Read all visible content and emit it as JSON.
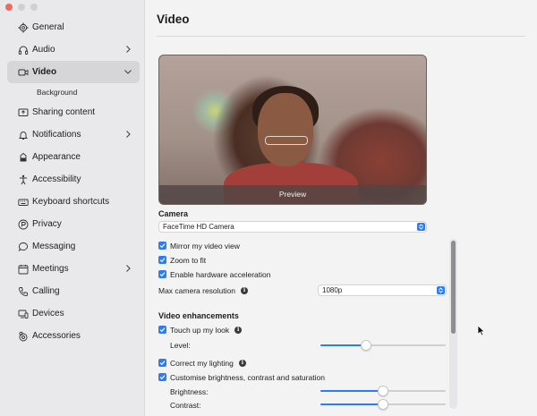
{
  "sidebar": {
    "items": [
      {
        "label": "General",
        "icon": "gear-icon"
      },
      {
        "label": "Audio",
        "icon": "headphones-icon",
        "chevron": true
      },
      {
        "label": "Video",
        "icon": "video-camera-icon",
        "active": true,
        "chevron": true
      },
      {
        "label": "Sharing content",
        "icon": "share-screen-icon"
      },
      {
        "label": "Notifications",
        "icon": "bell-icon",
        "chevron": true
      },
      {
        "label": "Appearance",
        "icon": "appearance-icon"
      },
      {
        "label": "Accessibility",
        "icon": "accessibility-icon"
      },
      {
        "label": "Keyboard shortcuts",
        "icon": "keyboard-icon"
      },
      {
        "label": "Privacy",
        "icon": "privacy-icon"
      },
      {
        "label": "Messaging",
        "icon": "chat-bubble-icon"
      },
      {
        "label": "Meetings",
        "icon": "calendar-icon",
        "chevron": true
      },
      {
        "label": "Calling",
        "icon": "phone-icon"
      },
      {
        "label": "Devices",
        "icon": "devices-icon"
      },
      {
        "label": "Accessories",
        "icon": "accessories-icon"
      }
    ],
    "sub_item": "Background"
  },
  "main": {
    "title": "Video",
    "preview_label": "Preview",
    "camera": {
      "heading": "Camera",
      "selected": "FaceTime HD Camera"
    },
    "options": {
      "mirror": "Mirror my video view",
      "zoom": "Zoom to fit",
      "hardware": "Enable hardware acceleration"
    },
    "resolution": {
      "label": "Max camera resolution",
      "selected": "1080p"
    },
    "enhancements": {
      "heading": "Video enhancements",
      "touch_up": "Touch up my look",
      "level_label": "Level:",
      "level_value": 0.35,
      "lighting": "Correct my lighting",
      "customise": "Customise brightness, contrast and saturation",
      "brightness_label": "Brightness:",
      "brightness_value": 0.5,
      "contrast_label": "Contrast:",
      "contrast_value": 0.5
    }
  },
  "colors": {
    "accent": "#2d7cf6",
    "sidebar_bg": "#e9e8ea",
    "active_bg": "#d6d5d8"
  }
}
